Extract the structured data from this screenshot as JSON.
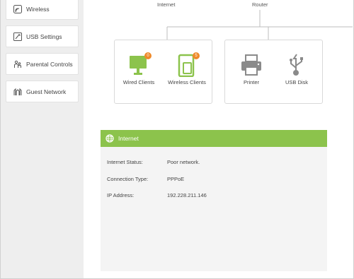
{
  "sidebar": {
    "items": [
      {
        "label": "Wireless",
        "icon": "wireless-icon"
      },
      {
        "label": "USB Settings",
        "icon": "usb-settings-icon"
      },
      {
        "label": "Parental Controls",
        "icon": "parental-controls-icon"
      },
      {
        "label": "Guest Network",
        "icon": "guest-network-icon"
      }
    ]
  },
  "topology": {
    "internet_label": "Internet",
    "router_label": "Router",
    "clients": [
      {
        "label": "Wired Clients",
        "count": "0",
        "icon": "monitor-icon"
      },
      {
        "label": "Wireless Clients",
        "count": "5",
        "icon": "tablet-icon"
      }
    ],
    "usb": [
      {
        "label": "Printer",
        "icon": "printer-icon"
      },
      {
        "label": "USB Disk",
        "icon": "usb-icon"
      }
    ]
  },
  "internet_panel": {
    "title": "Internet",
    "rows": [
      {
        "key": "Internet Status:",
        "value": "Poor network."
      },
      {
        "key": "Connection Type:",
        "value": "PPPoE"
      },
      {
        "key": "IP Address:",
        "value": "192.228.211.146"
      }
    ]
  },
  "colors": {
    "accent_green": "#8cc34c",
    "badge_orange": "#ef8a2a",
    "sidebar_bg": "#eeeeee",
    "inactive_icon": "#8a8a8a"
  }
}
